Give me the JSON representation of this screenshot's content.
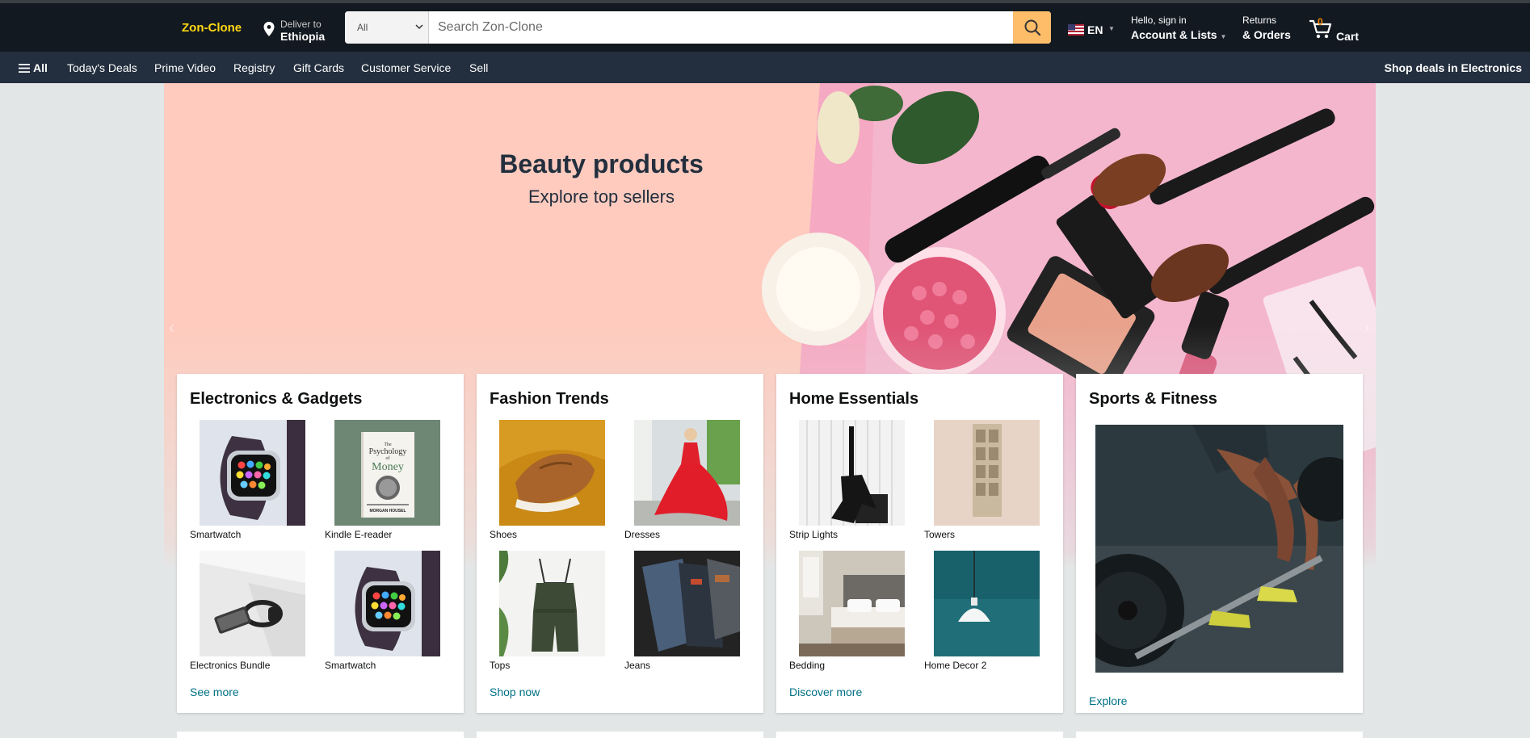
{
  "header": {
    "logo": "Zon-Clone",
    "deliver_line1": "Deliver to",
    "deliver_line2": "Ethiopia",
    "search_category": "All",
    "search_placeholder": "Search Zon-Clone",
    "language": "EN",
    "account_line1": "Hello, sign in",
    "account_line2": "Account & Lists",
    "orders_line1": "Returns",
    "orders_line2": "& Orders",
    "cart_count": "0",
    "cart_label": "Cart"
  },
  "nav": {
    "all": "All",
    "items": [
      "Today's Deals",
      "Prime Video",
      "Registry",
      "Gift Cards",
      "Customer Service",
      "Sell"
    ],
    "right": "Shop deals in Electronics"
  },
  "hero": {
    "title": "Beauty products",
    "subtitle": "Explore top sellers",
    "prev": "‹",
    "next": "›"
  },
  "cards": [
    {
      "title": "Electronics & Gadgets",
      "items": [
        "Smartwatch",
        "Kindle E-reader",
        "Electronics Bundle",
        "Smartwatch"
      ],
      "link": "See more"
    },
    {
      "title": "Fashion Trends",
      "items": [
        "Shoes",
        "Dresses",
        "Tops",
        "Jeans"
      ],
      "link": "Shop now"
    },
    {
      "title": "Home Essentials",
      "items": [
        "Strip Lights",
        "Towers",
        "Bedding",
        "Home Decor 2"
      ],
      "link": "Discover more"
    },
    {
      "title": "Sports & Fitness",
      "link": "Explore"
    }
  ],
  "book": {
    "line1": "The",
    "line2": "Psychology",
    "line3": "of",
    "line4": "Money",
    "author": "MORGAN HOUSEL"
  },
  "colors": {
    "header_bg": "#131921",
    "nav_bg": "#232f3e",
    "logo": "#ffd814",
    "search_button": "#febd69",
    "link": "#007185",
    "hero_bg": "#fecbbe"
  }
}
